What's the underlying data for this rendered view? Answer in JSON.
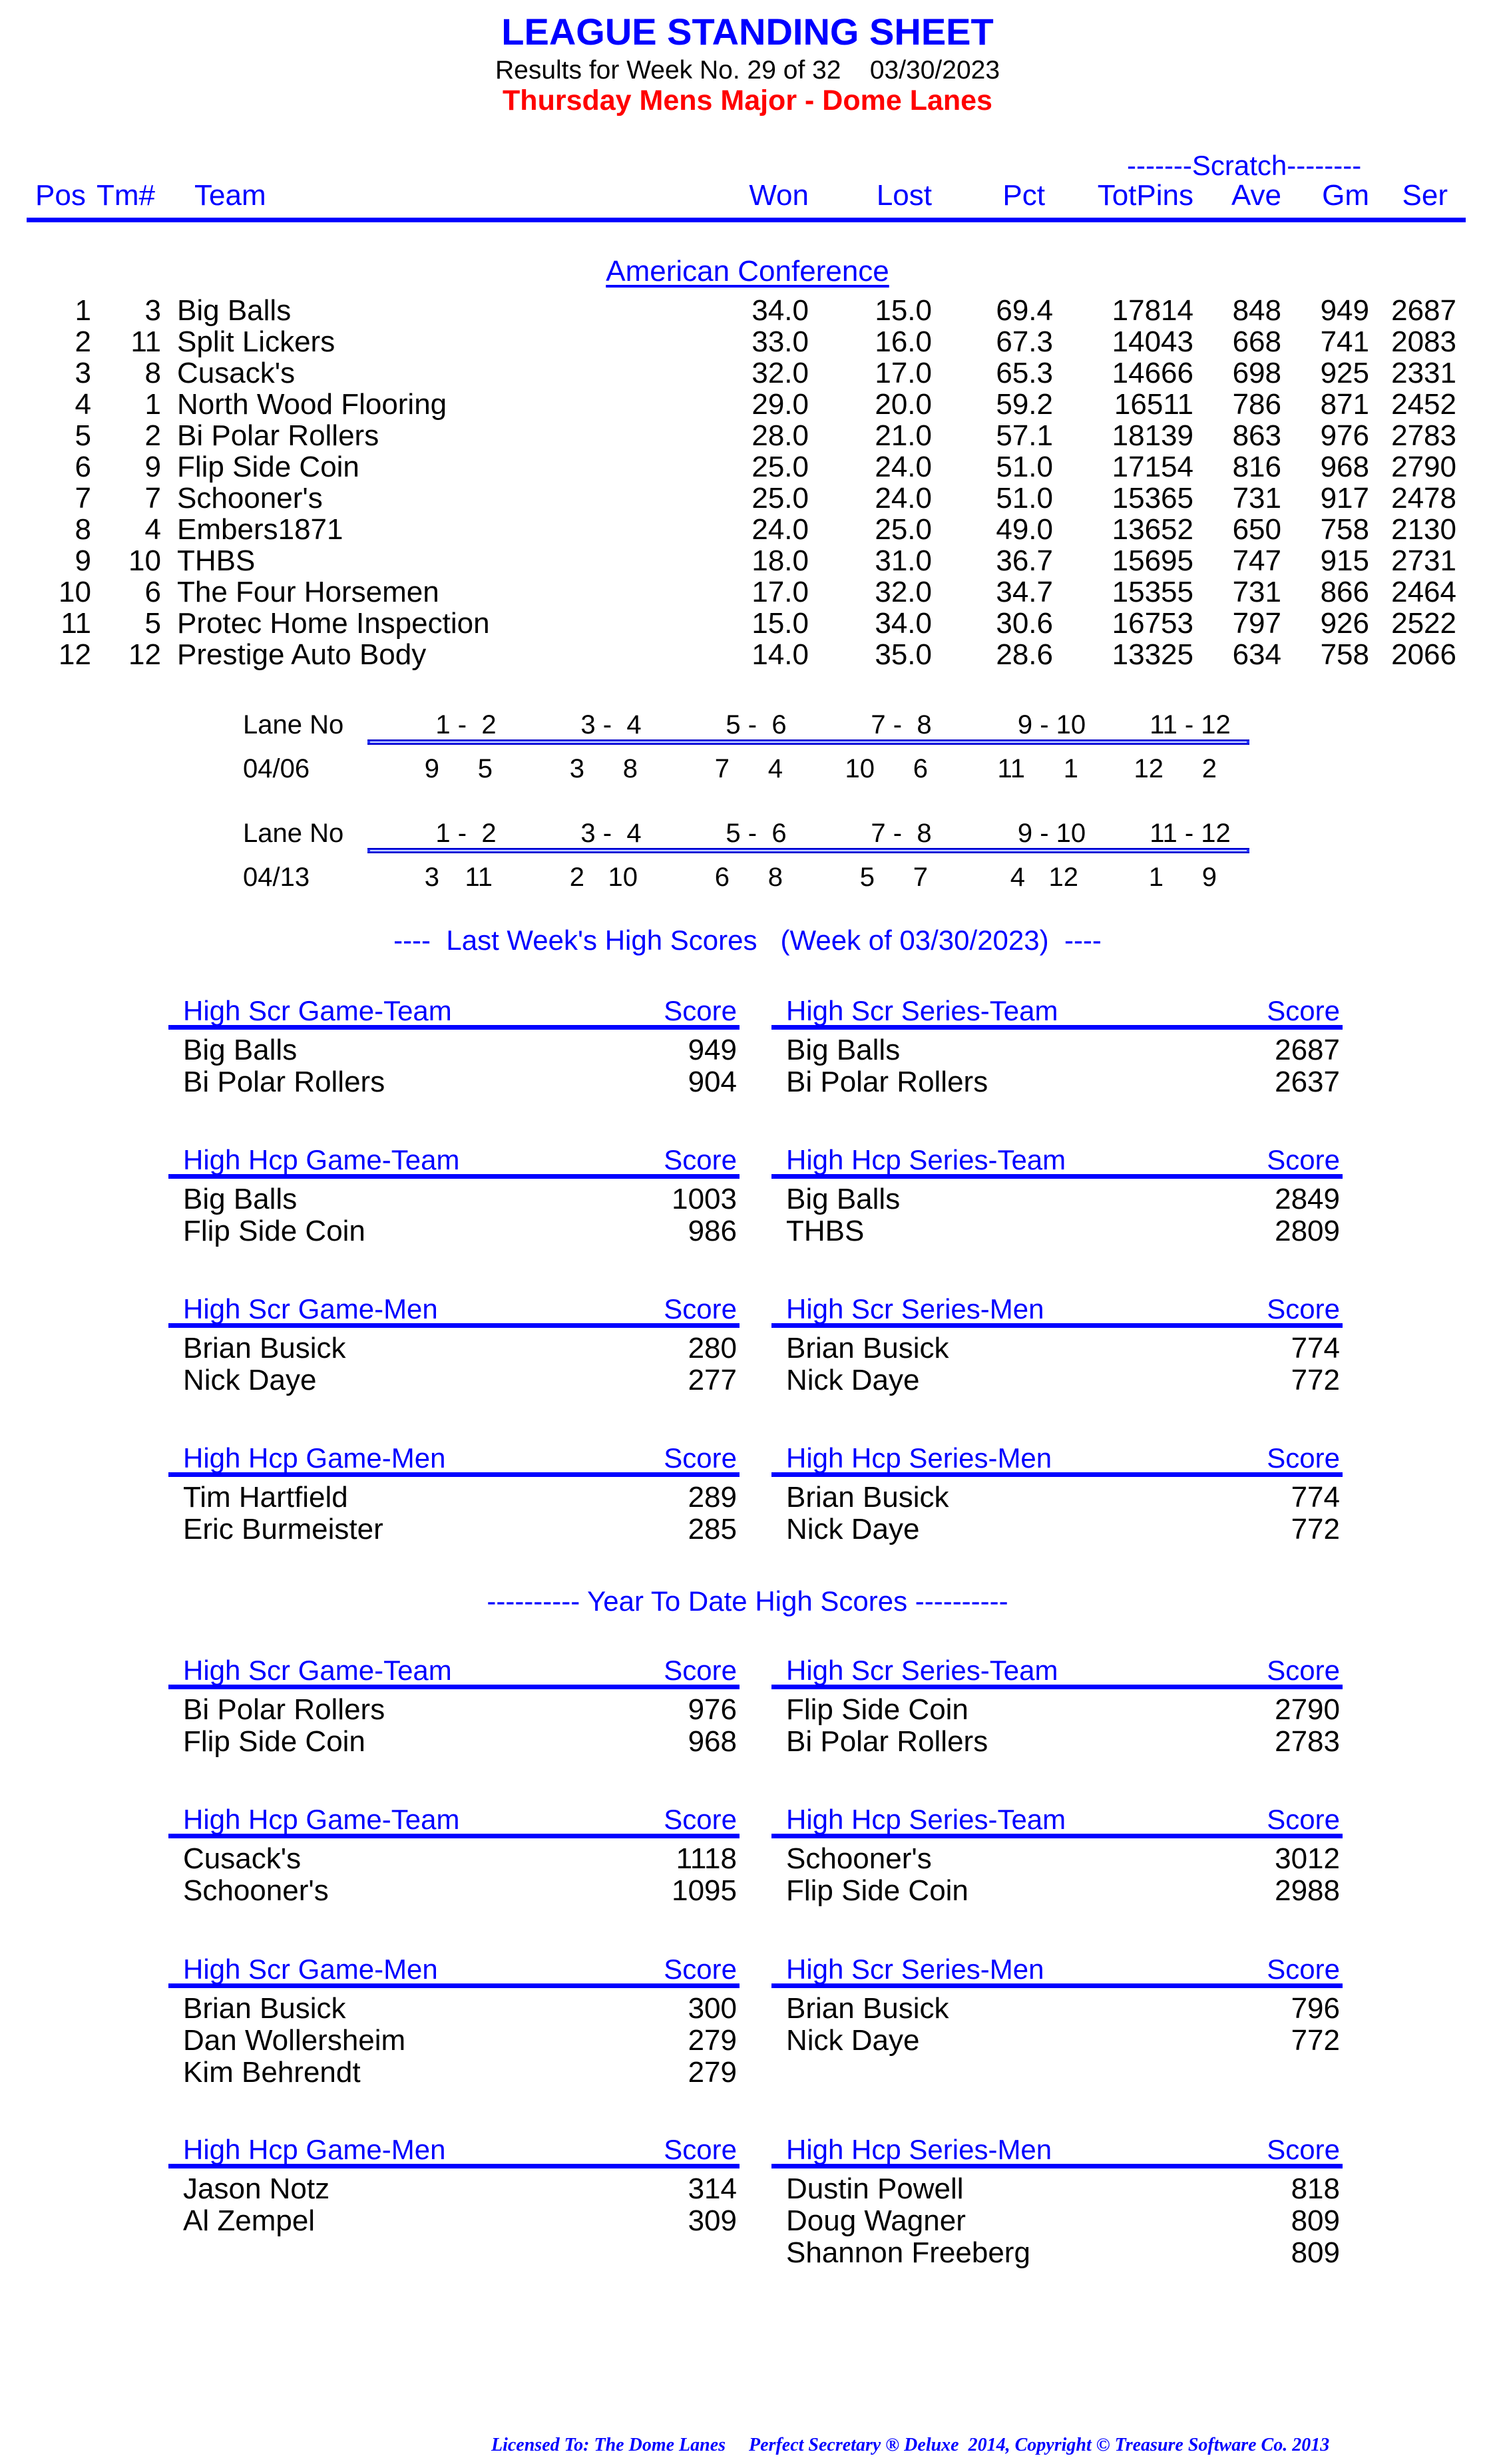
{
  "header": {
    "title": "LEAGUE STANDING SHEET",
    "subtitle": "Results for Week No. 29 of 32    03/30/2023",
    "league": "Thursday Mens Major - Dome Lanes"
  },
  "standings": {
    "scratch_label": "-------Scratch--------",
    "columns": {
      "pos": "Pos",
      "tm": "Tm#",
      "team": "Team",
      "won": "Won",
      "lost": "Lost",
      "pct": "Pct",
      "totpins": "TotPins",
      "ave": "Ave",
      "gm": "Gm",
      "ser": "Ser"
    },
    "conference": "American Conference",
    "rows": [
      {
        "pos": "1",
        "tm": "3",
        "team": "Big Balls",
        "won": "34.0",
        "lost": "15.0",
        "pct": "69.4",
        "totpins": "17814",
        "ave": "848",
        "gm": "949",
        "ser": "2687"
      },
      {
        "pos": "2",
        "tm": "11",
        "team": "Split Lickers",
        "won": "33.0",
        "lost": "16.0",
        "pct": "67.3",
        "totpins": "14043",
        "ave": "668",
        "gm": "741",
        "ser": "2083"
      },
      {
        "pos": "3",
        "tm": "8",
        "team": "Cusack's",
        "won": "32.0",
        "lost": "17.0",
        "pct": "65.3",
        "totpins": "14666",
        "ave": "698",
        "gm": "925",
        "ser": "2331"
      },
      {
        "pos": "4",
        "tm": "1",
        "team": "North Wood Flooring",
        "won": "29.0",
        "lost": "20.0",
        "pct": "59.2",
        "totpins": "16511",
        "ave": "786",
        "gm": "871",
        "ser": "2452"
      },
      {
        "pos": "5",
        "tm": "2",
        "team": "Bi Polar Rollers",
        "won": "28.0",
        "lost": "21.0",
        "pct": "57.1",
        "totpins": "18139",
        "ave": "863",
        "gm": "976",
        "ser": "2783"
      },
      {
        "pos": "6",
        "tm": "9",
        "team": "Flip Side Coin",
        "won": "25.0",
        "lost": "24.0",
        "pct": "51.0",
        "totpins": "17154",
        "ave": "816",
        "gm": "968",
        "ser": "2790"
      },
      {
        "pos": "7",
        "tm": "7",
        "team": "Schooner's",
        "won": "25.0",
        "lost": "24.0",
        "pct": "51.0",
        "totpins": "15365",
        "ave": "731",
        "gm": "917",
        "ser": "2478"
      },
      {
        "pos": "8",
        "tm": "4",
        "team": "Embers1871",
        "won": "24.0",
        "lost": "25.0",
        "pct": "49.0",
        "totpins": "13652",
        "ave": "650",
        "gm": "758",
        "ser": "2130"
      },
      {
        "pos": "9",
        "tm": "10",
        "team": "THBS",
        "won": "18.0",
        "lost": "31.0",
        "pct": "36.7",
        "totpins": "15695",
        "ave": "747",
        "gm": "915",
        "ser": "2731"
      },
      {
        "pos": "10",
        "tm": "6",
        "team": "The Four Horsemen",
        "won": "17.0",
        "lost": "32.0",
        "pct": "34.7",
        "totpins": "15355",
        "ave": "731",
        "gm": "866",
        "ser": "2464"
      },
      {
        "pos": "11",
        "tm": "5",
        "team": "Protec Home Inspection",
        "won": "15.0",
        "lost": "34.0",
        "pct": "30.6",
        "totpins": "16753",
        "ave": "797",
        "gm": "926",
        "ser": "2522"
      },
      {
        "pos": "12",
        "tm": "12",
        "team": "Prestige Auto Body",
        "won": "14.0",
        "lost": "35.0",
        "pct": "28.6",
        "totpins": "13325",
        "ave": "634",
        "gm": "758",
        "ser": "2066"
      }
    ]
  },
  "lanes": {
    "label": "Lane No",
    "pairs": [
      "1 -  2",
      "3 -  4",
      "5 -  6",
      "7 -  8",
      "9 - 10",
      "11 - 12"
    ],
    "schedules": [
      {
        "date": "04/06",
        "matchups": [
          [
            "9",
            "5"
          ],
          [
            "3",
            "8"
          ],
          [
            "7",
            "4"
          ],
          [
            "10",
            "6"
          ],
          [
            "11",
            "1"
          ],
          [
            "12",
            "2"
          ]
        ]
      },
      {
        "date": "04/13",
        "matchups": [
          [
            "3",
            "11"
          ],
          [
            "2",
            "10"
          ],
          [
            "6",
            "8"
          ],
          [
            "5",
            "7"
          ],
          [
            "4",
            "12"
          ],
          [
            "1",
            "9"
          ]
        ]
      }
    ]
  },
  "last_week": {
    "title": "----  Last Week's High Scores   (Week of 03/30/2023)  ----",
    "score_label": "Score",
    "blocks": [
      {
        "title": "High Scr Game-Team",
        "rows": [
          [
            "Big Balls",
            "949"
          ],
          [
            "Bi Polar Rollers",
            "904"
          ]
        ]
      },
      {
        "title": "High Scr Series-Team",
        "rows": [
          [
            "Big Balls",
            "2687"
          ],
          [
            "Bi Polar Rollers",
            "2637"
          ]
        ]
      },
      {
        "title": "High Hcp Game-Team",
        "rows": [
          [
            "Big Balls",
            "1003"
          ],
          [
            "Flip Side Coin",
            "986"
          ]
        ]
      },
      {
        "title": "High Hcp Series-Team",
        "rows": [
          [
            "Big Balls",
            "2849"
          ],
          [
            "THBS",
            "2809"
          ]
        ]
      },
      {
        "title": "High Scr Game-Men",
        "rows": [
          [
            "Brian Busick",
            "280"
          ],
          [
            "Nick Daye",
            "277"
          ]
        ]
      },
      {
        "title": "High Scr Series-Men",
        "rows": [
          [
            "Brian Busick",
            "774"
          ],
          [
            "Nick Daye",
            "772"
          ]
        ]
      },
      {
        "title": "High Hcp Game-Men",
        "rows": [
          [
            "Tim Hartfield",
            "289"
          ],
          [
            "Eric Burmeister",
            "285"
          ]
        ]
      },
      {
        "title": "High Hcp Series-Men",
        "rows": [
          [
            "Brian Busick",
            "774"
          ],
          [
            "Nick Daye",
            "772"
          ]
        ]
      }
    ]
  },
  "year_to_date": {
    "title": "---------- Year To Date High Scores ----------",
    "score_label": "Score",
    "blocks": [
      {
        "title": "High Scr Game-Team",
        "rows": [
          [
            "Bi Polar Rollers",
            "976"
          ],
          [
            "Flip Side Coin",
            "968"
          ]
        ]
      },
      {
        "title": "High Scr Series-Team",
        "rows": [
          [
            "Flip Side Coin",
            "2790"
          ],
          [
            "Bi Polar Rollers",
            "2783"
          ]
        ]
      },
      {
        "title": "High Hcp Game-Team",
        "rows": [
          [
            "Cusack's",
            "1118"
          ],
          [
            "Schooner's",
            "1095"
          ]
        ]
      },
      {
        "title": "High Hcp Series-Team",
        "rows": [
          [
            "Schooner's",
            "3012"
          ],
          [
            "Flip Side Coin",
            "2988"
          ]
        ]
      },
      {
        "title": "High Scr Game-Men",
        "rows": [
          [
            "Brian Busick",
            "300"
          ],
          [
            "Dan Wollersheim",
            "279"
          ],
          [
            "Kim Behrendt",
            "279"
          ]
        ]
      },
      {
        "title": "High Scr Series-Men",
        "rows": [
          [
            "Brian Busick",
            "796"
          ],
          [
            "Nick Daye",
            "772"
          ]
        ]
      },
      {
        "title": "High Hcp Game-Men",
        "rows": [
          [
            "Jason Notz",
            "314"
          ],
          [
            "Al Zempel",
            "309"
          ]
        ]
      },
      {
        "title": "High Hcp Series-Men",
        "rows": [
          [
            "Dustin Powell",
            "818"
          ],
          [
            "Doug Wagner",
            "809"
          ],
          [
            "Shannon Freeberg",
            "809"
          ]
        ]
      }
    ]
  },
  "footer": "Licensed To: The Dome Lanes     Perfect Secretary ® Deluxe  2014, Copyright © Treasure Software Co. 2013",
  "colors": {
    "accent": "#0000ff",
    "league": "#ff0000",
    "text": "#000000"
  }
}
